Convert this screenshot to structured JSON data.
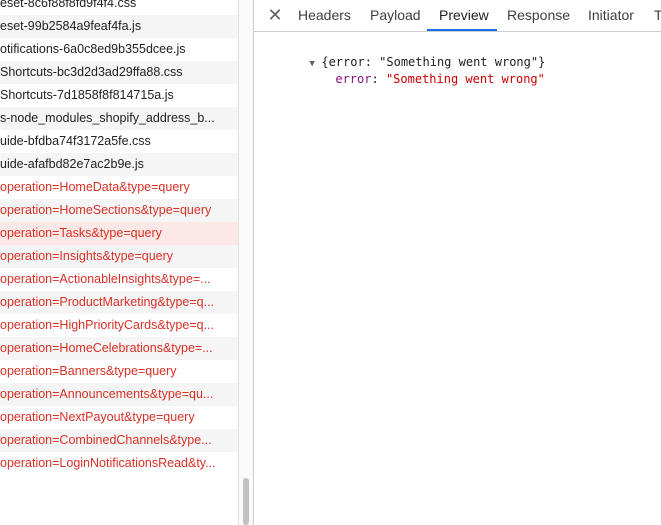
{
  "requests": [
    {
      "name": "eset-8c6f88f8fd9f4f4.css",
      "state": "normal"
    },
    {
      "name": "eset-99b2584a9feaf4fa.js",
      "state": "normal"
    },
    {
      "name": "otifications-6a0c8ed9b355dcee.js",
      "state": "normal"
    },
    {
      "name": "Shortcuts-bc3d2d3ad29ffa88.css",
      "state": "normal"
    },
    {
      "name": "Shortcuts-7d1858f8f814715a.js",
      "state": "normal"
    },
    {
      "name": "s-node_modules_shopify_address_b...",
      "state": "normal"
    },
    {
      "name": "uide-bfdba74f3172a5fe.css",
      "state": "normal"
    },
    {
      "name": "uide-afafbd82e7ac2b9e.js",
      "state": "normal"
    },
    {
      "name": "operation=HomeData&type=query",
      "state": "error"
    },
    {
      "name": "operation=HomeSections&type=query",
      "state": "error"
    },
    {
      "name": "operation=Tasks&type=query",
      "state": "selected"
    },
    {
      "name": "operation=Insights&type=query",
      "state": "error"
    },
    {
      "name": "operation=ActionableInsights&type=...",
      "state": "error"
    },
    {
      "name": "operation=ProductMarketing&type=q...",
      "state": "error"
    },
    {
      "name": "operation=HighPriorityCards&type=q...",
      "state": "error"
    },
    {
      "name": "operation=HomeCelebrations&type=...",
      "state": "error"
    },
    {
      "name": "operation=Banners&type=query",
      "state": "error"
    },
    {
      "name": "operation=Announcements&type=qu...",
      "state": "error"
    },
    {
      "name": "operation=NextPayout&type=query",
      "state": "error"
    },
    {
      "name": "operation=CombinedChannels&type...",
      "state": "error"
    },
    {
      "name": "operation=LoginNotificationsRead&ty...",
      "state": "error"
    }
  ],
  "tabs": [
    "Headers",
    "Payload",
    "Preview",
    "Response",
    "Initiator",
    "T"
  ],
  "active_tab": "Preview",
  "icons": {
    "close": "close-icon",
    "expand": "triangle-down-icon"
  },
  "preview": {
    "summary": "{error: \"Something went wrong\"}",
    "key": "error",
    "colon": ": ",
    "value": "\"Something went wrong\""
  },
  "colors": {
    "error_text": "#d93025",
    "selected_row_bg": "#fce8e6",
    "active_tab_underline": "#1a73e8",
    "json_key": "#881280",
    "json_string": "#c80000"
  }
}
